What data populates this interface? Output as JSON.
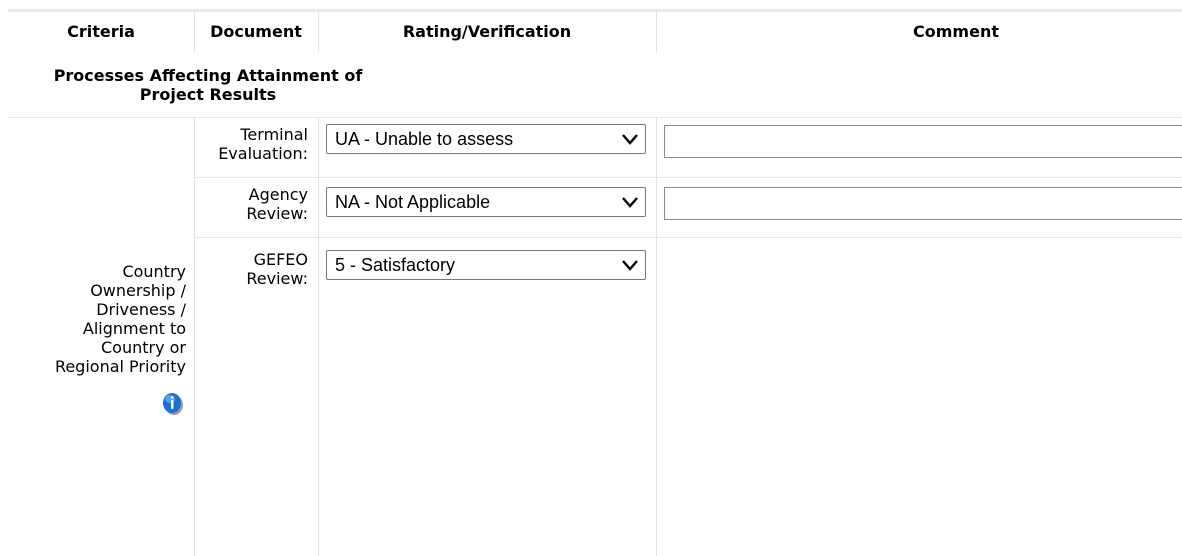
{
  "table": {
    "headers": {
      "criteria": "Criteria",
      "document": "Document",
      "rating": "Rating/Verification",
      "comment": "Comment"
    },
    "section_title_line1": "Processes Affecting Attainment of",
    "section_title_line2": "Project Results",
    "criteria_lines": [
      "Country",
      "Ownership /",
      "Driveness /",
      "Alignment to",
      "Country or",
      "Regional Priority"
    ],
    "rows": [
      {
        "doc_line1": "Terminal",
        "doc_line2": "Evaluation:",
        "rating": "UA - Unable to assess",
        "comment": ""
      },
      {
        "doc_line1": "Agency",
        "doc_line2": "Review:",
        "rating": "NA - Not Applicable",
        "comment": ""
      },
      {
        "doc_line1": "GEFEO",
        "doc_line2": "Review:",
        "rating": "5 - Satisfactory"
      }
    ]
  },
  "icons": {
    "info": "info-icon"
  }
}
